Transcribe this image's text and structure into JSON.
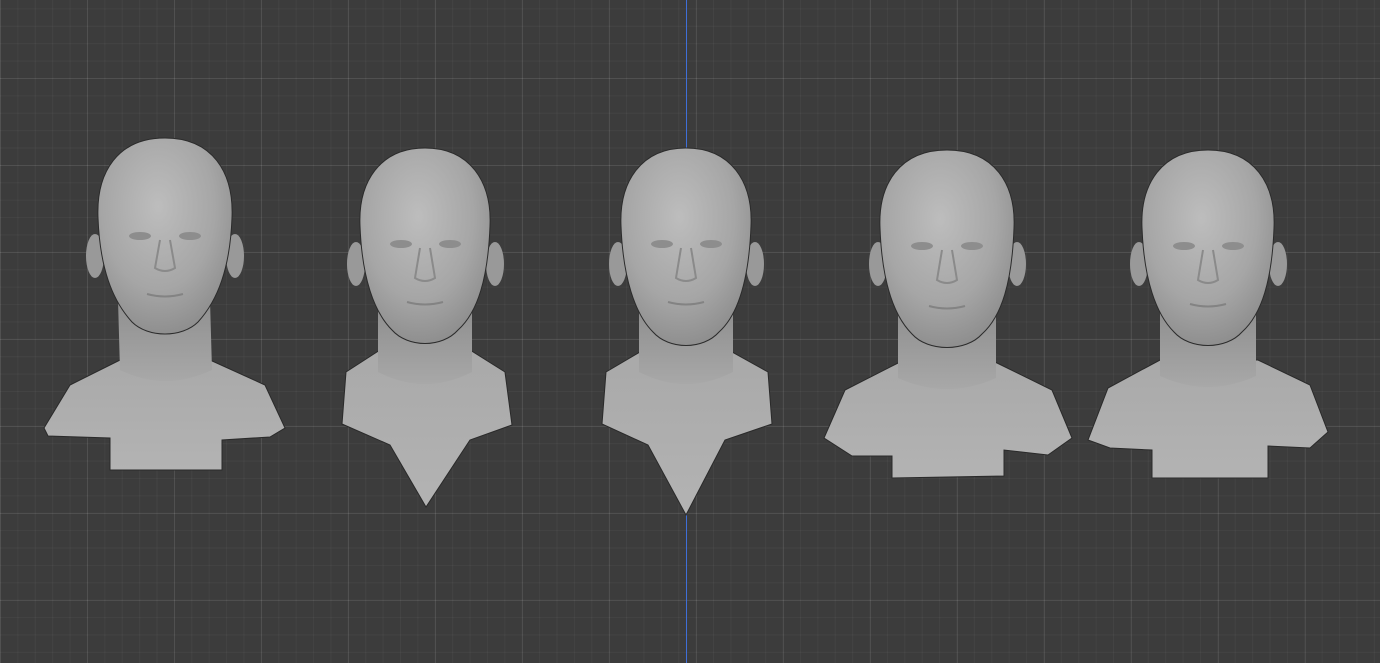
{
  "viewport": {
    "grid_color": "#4a4a4a",
    "background_color": "#3c3c3c",
    "axis_color": "#3f6fd8"
  },
  "objects": [
    {
      "name": "head-1",
      "collar": "shoulders",
      "color": "#a9a9a9"
    },
    {
      "name": "head-2",
      "collar": "v-neck",
      "color": "#a9a9a9"
    },
    {
      "name": "head-3",
      "collar": "v-neck",
      "color": "#a9a9a9"
    },
    {
      "name": "head-4",
      "collar": "shoulders",
      "color": "#a9a9a9"
    },
    {
      "name": "head-5",
      "collar": "shoulders",
      "color": "#a9a9a9"
    }
  ]
}
